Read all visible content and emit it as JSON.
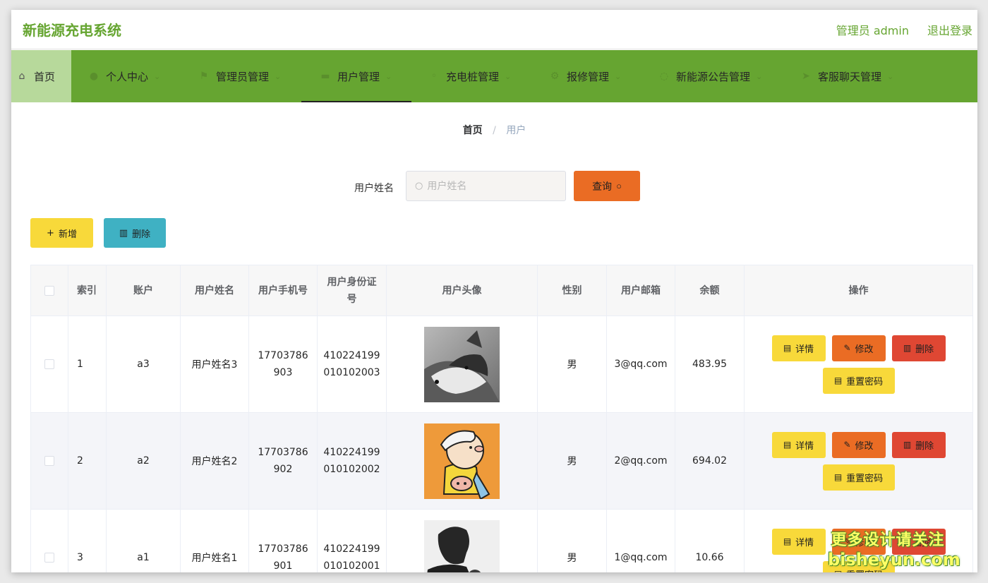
{
  "app": {
    "title": "新能源充电系统",
    "user_label": "管理员 admin",
    "logout": "退出登录"
  },
  "nav": {
    "items": [
      {
        "label": "首页",
        "icon": "home-icon"
      },
      {
        "label": "个人中心",
        "icon": "user-icon"
      },
      {
        "label": "管理员管理",
        "icon": "flag-icon"
      },
      {
        "label": "用户管理",
        "icon": "folder-icon"
      },
      {
        "label": "充电桩管理",
        "icon": "pin-icon"
      },
      {
        "label": "报修管理",
        "icon": "wrench-icon"
      },
      {
        "label": "新能源公告管理",
        "icon": "bell-icon"
      },
      {
        "label": "客服聊天管理",
        "icon": "chat-icon"
      }
    ],
    "active": "用户管理"
  },
  "breadcrumb": {
    "home": "首页",
    "separator": "/",
    "current": "用户"
  },
  "search": {
    "label": "用户姓名",
    "placeholder": "用户姓名",
    "value": "",
    "button": "查询"
  },
  "toolbar": {
    "add": "新增",
    "delete": "删除"
  },
  "table": {
    "columns": [
      "索引",
      "账户",
      "用户姓名",
      "用户手机号",
      "用户身份证号",
      "用户头像",
      "性别",
      "用户邮箱",
      "余额",
      "操作"
    ],
    "rows": [
      {
        "index": "1",
        "account": "a3",
        "name": "用户姓名3",
        "phone_a": "17703786",
        "phone_b": "903",
        "id_a": "410224199",
        "id_b": "010102003",
        "gender": "男",
        "email": "3@qq.com",
        "balance": "483.95"
      },
      {
        "index": "2",
        "account": "a2",
        "name": "用户姓名2",
        "phone_a": "17703786",
        "phone_b": "902",
        "id_a": "410224199",
        "id_b": "010102002",
        "gender": "男",
        "email": "2@qq.com",
        "balance": "694.02"
      },
      {
        "index": "3",
        "account": "a1",
        "name": "用户姓名1",
        "phone_a": "17703786",
        "phone_b": "901",
        "id_a": "410224199",
        "id_b": "010102001",
        "gender": "男",
        "email": "1@qq.com",
        "balance": "10.66"
      }
    ],
    "ops": {
      "detail": "详情",
      "edit": "修改",
      "delete": "删除",
      "reset": "重置密码"
    }
  },
  "watermark": {
    "line1": "更多设计请关注",
    "line2": "bisheyun.com"
  },
  "colors": {
    "primary_green": "#66a531",
    "nav_bg": "#66a531",
    "yellow": "#f8d93a",
    "orange": "#ea6c24",
    "red": "#df4733",
    "teal": "#3fb1c3"
  }
}
